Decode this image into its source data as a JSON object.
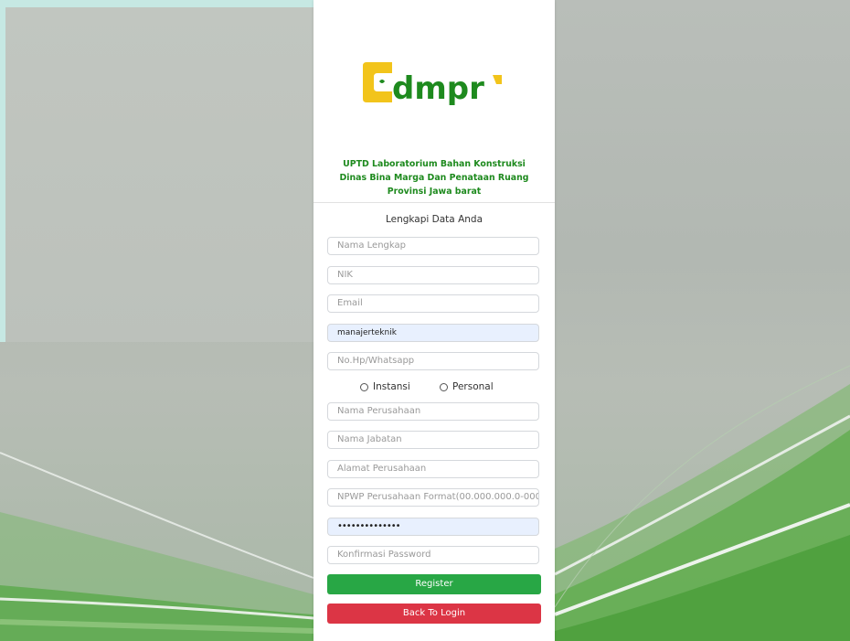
{
  "brand": {
    "logo_text": "dmpr",
    "org_lines": [
      "UPTD Laboratorium Bahan Konstruksi",
      "Dinas Bina Marga Dan Penataan Ruang",
      "Provinsi Jawa barat"
    ]
  },
  "form": {
    "title": "Lengkapi Data Anda",
    "nama_lengkap": {
      "placeholder": "Nama Lengkap",
      "value": ""
    },
    "nik": {
      "placeholder": "NIK",
      "value": ""
    },
    "email": {
      "placeholder": "Email",
      "value": ""
    },
    "username": {
      "placeholder": "",
      "value": "manajerteknik"
    },
    "phone": {
      "placeholder": "No.Hp/Whatsapp",
      "value": ""
    },
    "type_options": [
      "Instansi",
      "Personal"
    ],
    "nama_perusahaan": {
      "placeholder": "Nama Perusahaan",
      "value": ""
    },
    "nama_jabatan": {
      "placeholder": "Nama Jabatan",
      "value": ""
    },
    "alamat_perusahaan": {
      "placeholder": "Alamat Perusahaan",
      "value": ""
    },
    "npwp": {
      "placeholder": "NPWP Perusahaan Format(00.000.000.0-000",
      "value": ""
    },
    "password": {
      "placeholder": "",
      "value": "••••••••••••••"
    },
    "konfirmasi_password": {
      "placeholder": "Konfirmasi Password",
      "value": ""
    },
    "register_label": "Register",
    "back_label": "Back To Login"
  },
  "colors": {
    "brand_green": "#1e8a1e",
    "logo_yellow": "#f2c41b",
    "register_button": "#28a745",
    "back_button": "#dc3545",
    "autofill_bg": "#e8f0fe"
  }
}
